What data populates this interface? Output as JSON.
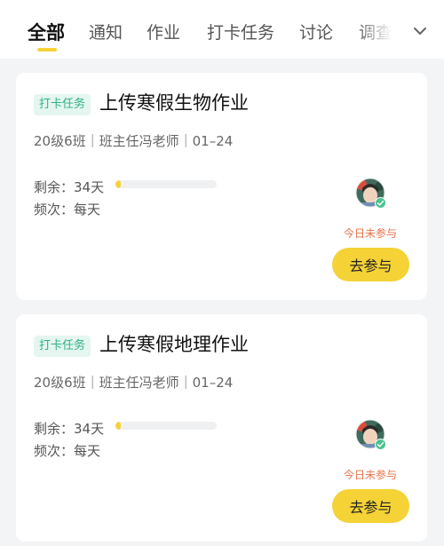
{
  "tabs": {
    "items": [
      {
        "label": "全部",
        "active": true
      },
      {
        "label": "通知"
      },
      {
        "label": "作业"
      },
      {
        "label": "打卡任务"
      },
      {
        "label": "讨论"
      },
      {
        "label": "调查"
      }
    ],
    "more_icon": "chevron-down-icon"
  },
  "colors": {
    "accent_yellow": "#f5d236",
    "badge_green": "#2fb08a",
    "badge_bg": "#e4f6ef",
    "status_orange": "#e8734a",
    "page_bg": "#f3f4f6"
  },
  "tasks": [
    {
      "badge": "打卡任务",
      "title": "上传寒假生物作业",
      "meta": "20级6班｜班主任冯老师｜01–24",
      "remaining_label": "剩余：34天",
      "frequency_label": "频次：每天",
      "progress_fraction": 0.05,
      "status": "今日未参与",
      "action": "去参与"
    },
    {
      "badge": "打卡任务",
      "title": "上传寒假地理作业",
      "meta": "20级6班｜班主任冯老师｜01–24",
      "remaining_label": "剩余：34天",
      "frequency_label": "频次：每天",
      "progress_fraction": 0.05,
      "status": "今日未参与",
      "action": "去参与"
    }
  ]
}
